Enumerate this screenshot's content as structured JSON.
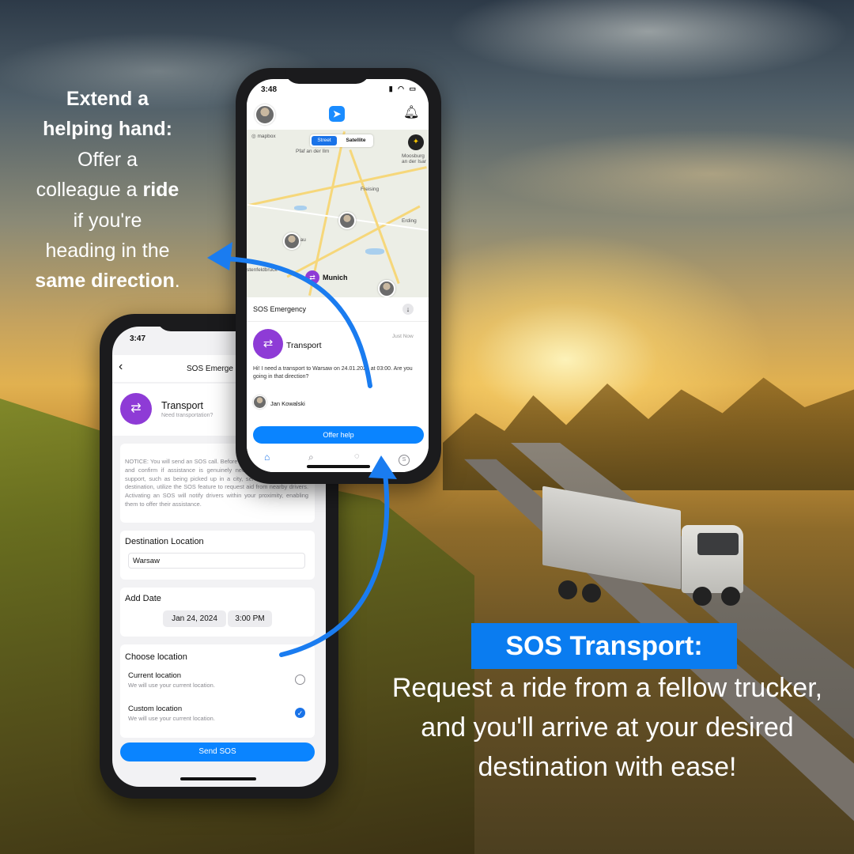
{
  "caption_left": {
    "line1": "Extend a",
    "line2": "helping hand:",
    "line3": "Offer a",
    "line4_pre": "colleague a",
    "line4_bold": "ride",
    "line5": "if you're",
    "line6": "heading in the",
    "line7_bold": "same direction",
    "line7_end": "."
  },
  "caption_right": {
    "title": "SOS Transport:",
    "body": "Request a ride from a fellow trucker, and you'll arrive at your desired destination with ease!"
  },
  "phone_form": {
    "time": "3:47",
    "nav_title": "SOS Emerge",
    "transport_title": "Transport",
    "transport_sub": "Need transportation?",
    "notice": "NOTICE: You will send an SOS call. Before initiating an SOS, evaluate and confirm if assistance is genuinely needed. For transportation support, such as being picked up in a city, service station, or your destination, utilize the SOS feature to request aid from nearby drivers. Activating an SOS will notify drivers within your proximity, enabling them to offer their assistance.",
    "destination_label": "Destination Location",
    "destination_value": "Warsaw",
    "date_label": "Add Date",
    "date_value": "Jan 24, 2024",
    "time_value": "3:00 PM",
    "location_label": "Choose location",
    "options": [
      {
        "title": "Current location",
        "sub": "We will use your current location.",
        "checked": false
      },
      {
        "title": "Custom location",
        "sub": "We will use your current location.",
        "checked": true
      }
    ],
    "send_button": "Send SOS"
  },
  "phone_map": {
    "time": "3:48",
    "map_type_active": "Street",
    "map_type_other": "Satellite",
    "places": {
      "munich": "Munich",
      "freising": "Freising",
      "erding": "Erding",
      "moosburg": "Moosburg an der Isar",
      "fuerstenfeldbruck": "stenfeldbruck",
      "dachau": "hau",
      "pfaffenhofen": "Pfaf an der Ilm"
    },
    "sheet_title": "SOS Emergency",
    "card_title": "Transport",
    "card_time": "Just Now",
    "message": "Hi! I need a transport to Warsaw on 24.01.2024 at 03:00. Are you going in that direction?",
    "sender": "Jan Kowalski",
    "offer_button": "Offer help",
    "tabs": [
      "home-icon",
      "search-icon",
      "chat-icon",
      "sos-icon"
    ]
  },
  "colors": {
    "accent": "#0a84ff",
    "purple": "#8e3bd6",
    "caption_box": "#0a7cf0"
  }
}
